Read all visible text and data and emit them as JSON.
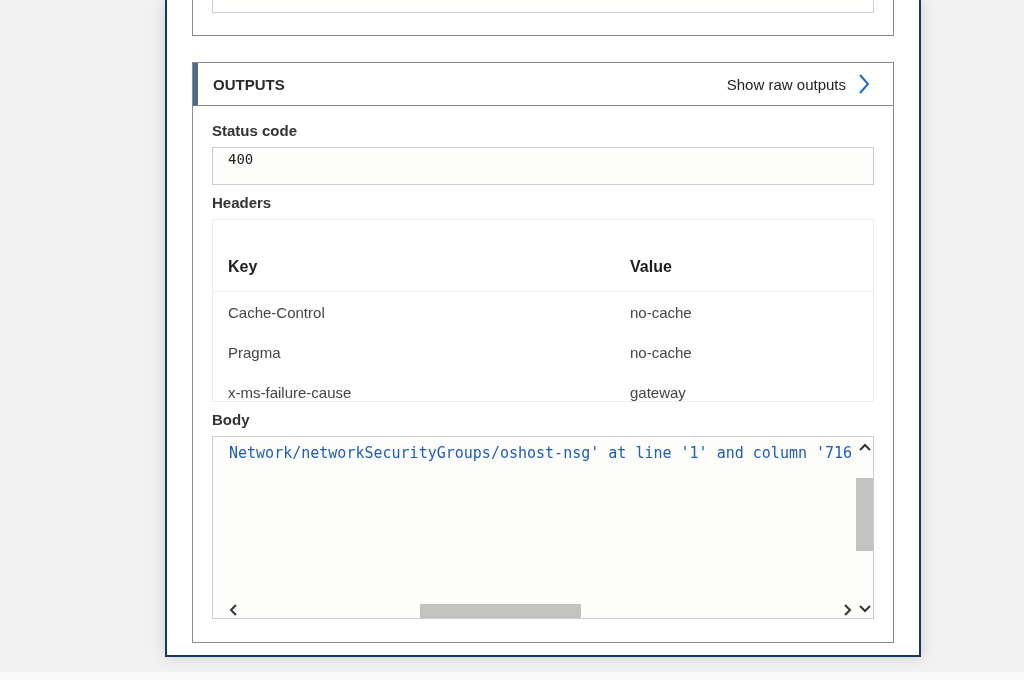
{
  "outputs": {
    "title": "OUTPUTS",
    "raw_link": "Show raw outputs",
    "status_code": {
      "label": "Status code",
      "value": "400"
    },
    "headers": {
      "label": "Headers",
      "columns": [
        "Key",
        "Value"
      ],
      "rows": [
        [
          "Cache-Control",
          "no-cache"
        ],
        [
          "Pragma",
          "no-cache"
        ],
        [
          "x-ms-failure-cause",
          "gateway"
        ]
      ]
    },
    "body": {
      "label": "Body",
      "text": "Network/networkSecurityGroups/oshost-nsg' at line '1' and column '716"
    }
  }
}
